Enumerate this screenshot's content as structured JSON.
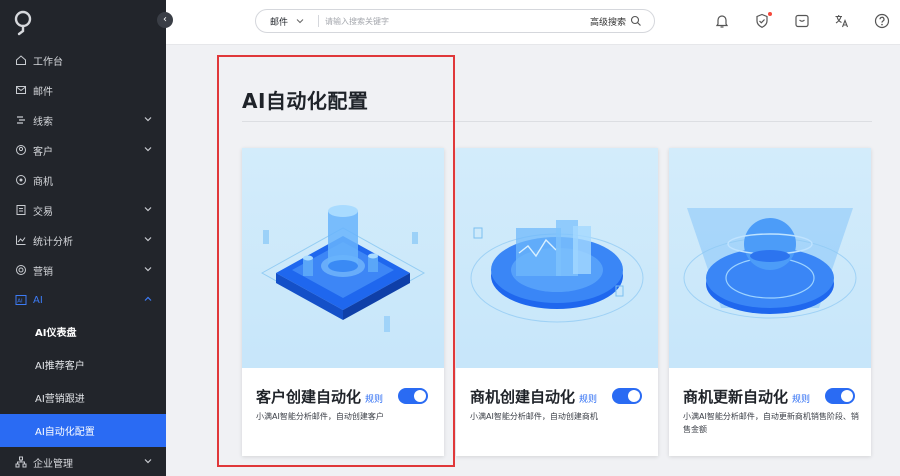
{
  "sidebar": {
    "collapse_icon": "chevron-left-icon",
    "items": [
      {
        "label": "工作台",
        "icon": "home-icon"
      },
      {
        "label": "邮件",
        "icon": "mail-icon"
      },
      {
        "label": "线索",
        "icon": "clue-icon"
      },
      {
        "label": "客户",
        "icon": "customer-icon"
      },
      {
        "label": "商机",
        "icon": "opportunity-icon"
      },
      {
        "label": "交易",
        "icon": "deal-icon"
      },
      {
        "label": "统计分析",
        "icon": "chart-icon"
      },
      {
        "label": "营销",
        "icon": "marketing-icon"
      },
      {
        "label": "AI",
        "icon": "ai-icon"
      }
    ],
    "ai_subitems": [
      "AI仪表盘",
      "AI推荐客户",
      "AI营销跟进",
      "AI自动化配置"
    ],
    "bottom_item": {
      "label": "企业管理",
      "icon": "org-icon"
    }
  },
  "topbar": {
    "search_scope": "邮件",
    "search_placeholder": "请输入搜索关键字",
    "advanced_search": "高级搜索"
  },
  "main": {
    "title": "AI自动化配置",
    "rule_label": "规则",
    "cards": [
      {
        "title": "客户创建自动化",
        "desc": "小满AI智能分析邮件，自动创建客户",
        "enabled": true
      },
      {
        "title": "商机创建自动化",
        "desc": "小满AI智能分析邮件，自动创建商机",
        "enabled": true
      },
      {
        "title": "商机更新自动化",
        "desc": "小满AI智能分析邮件，自动更新商机销售阶段、销售金额",
        "enabled": true
      }
    ]
  },
  "colors": {
    "accent": "#2a6bf3",
    "sidebar_bg": "#22252b",
    "highlight": "#e0383a"
  }
}
